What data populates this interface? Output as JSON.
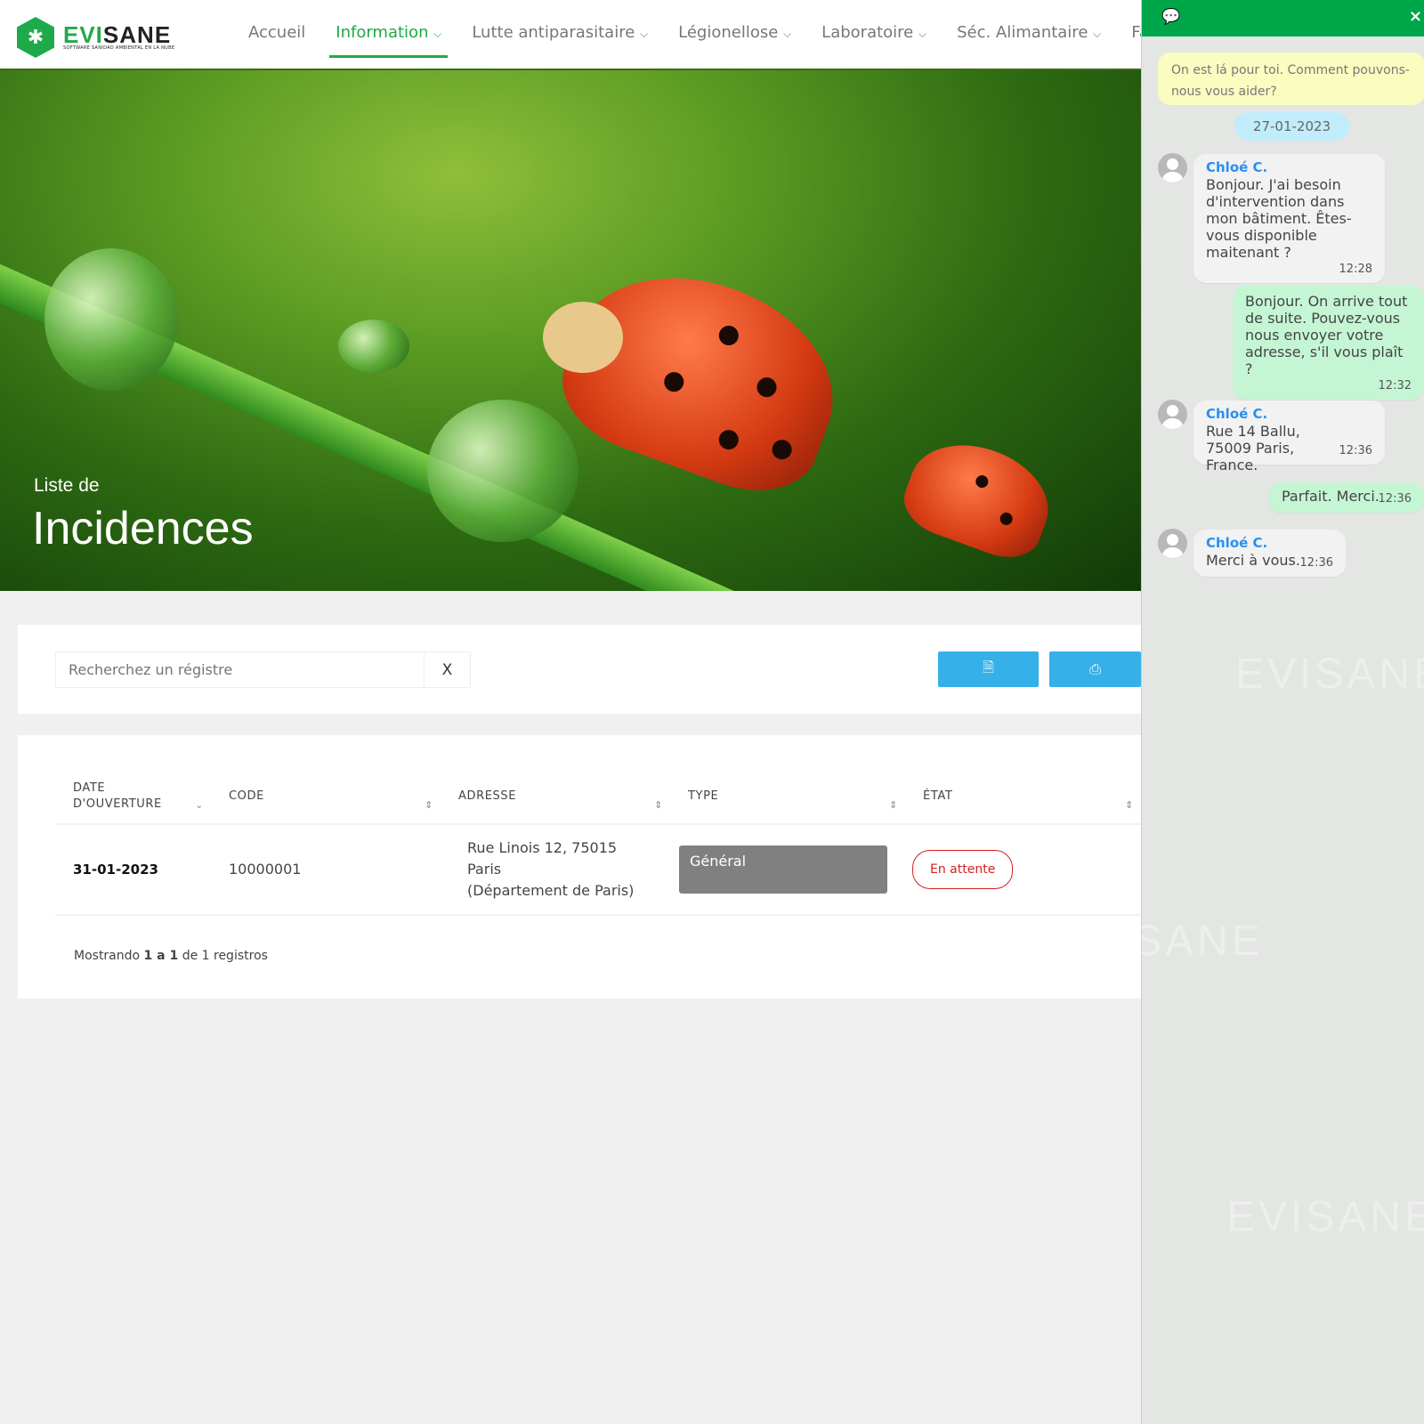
{
  "brand": {
    "name_a": "EVI",
    "name_b": "SANE",
    "tagline": "SOFTWARE SANIDAD AMBIENTAL EN LA NUBE"
  },
  "nav": [
    {
      "label": "Accueil",
      "dropdown": false
    },
    {
      "label": "Information",
      "dropdown": true,
      "active": true
    },
    {
      "label": "Lutte antiparasitaire",
      "dropdown": true
    },
    {
      "label": "Légionellose",
      "dropdown": true
    },
    {
      "label": "Laboratoire",
      "dropdown": true
    },
    {
      "label": "Séc. Alimantaire",
      "dropdown": true
    },
    {
      "label": "Fac",
      "dropdown": false
    }
  ],
  "hero": {
    "subtitle": "Liste de",
    "title": "Incidences"
  },
  "toolbar": {
    "search_placeholder": "Recherchez un régistre",
    "clear_label": "X",
    "excel_icon": "file-excel-icon",
    "print_icon": "print-icon"
  },
  "table": {
    "headers": [
      "DATE D'OUVERTURE",
      "CODE",
      "ADRESSE",
      "TYPE",
      "ÉTAT"
    ],
    "rows": [
      {
        "date": "31-01-2023",
        "code": "10000001",
        "address_line1": "Rue Linois 12, 75015 Paris",
        "address_line2": "(Département de Paris)",
        "type": "Général",
        "state": "En attente"
      }
    ],
    "footer": {
      "prefix": "Mostrando",
      "range": "1 a 1",
      "middle": "de 1 registros"
    }
  },
  "chat": {
    "welcome": "On est lá pour toi. Comment pouvons-nous vous aider?",
    "date": "27-01-2023",
    "messages": [
      {
        "from": "Chloé C.",
        "text": "Bonjour. J'ai besoin d'intervention dans mon bâtiment. Êtes-vous disponible maitenant ?",
        "time": "12:28"
      },
      {
        "from": "",
        "text": "Bonjour. On arrive tout de suite. Pouvez-vous nous envoyer votre adresse, s'il vous plaît ?",
        "time": "12:32"
      },
      {
        "from": "Chloé C.",
        "text": "Rue 14 Ballu, 75009 Paris, France.",
        "time": "12:36"
      },
      {
        "from": "",
        "text": "Parfait. Merci.",
        "time": "12:36"
      },
      {
        "from": "Chloé C.",
        "text": "Merci à vous.",
        "time": "12:36"
      }
    ],
    "close_label": "×"
  },
  "colors": {
    "accent": "#1faa4a",
    "chat_header": "#00a74a",
    "button": "#36b0e8",
    "state": "#d52020"
  }
}
